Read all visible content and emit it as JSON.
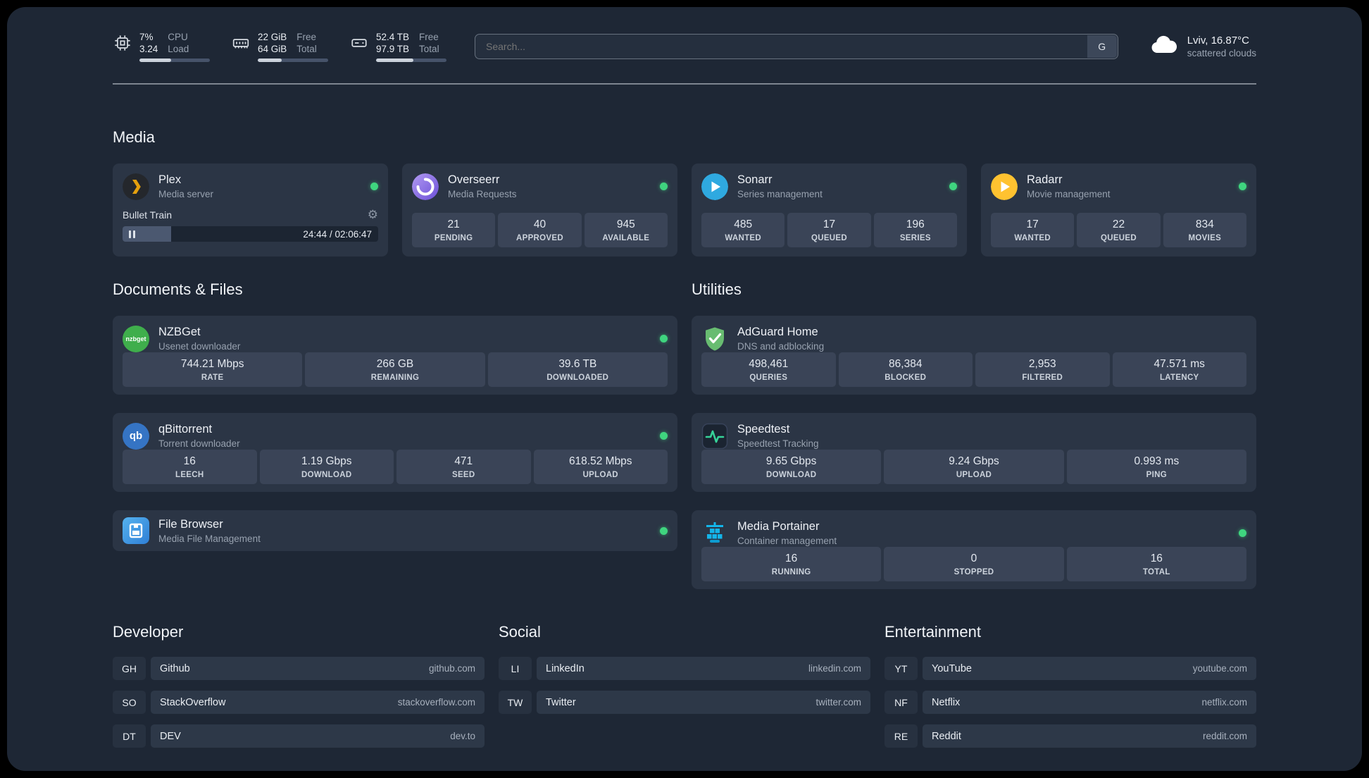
{
  "colors": {
    "page_bg": "#1e2735",
    "card_bg": "#2b3545",
    "status_online": "#3fd57f",
    "plex_amber": "#e5a00d",
    "sonarr_blue": "#2fa9e0",
    "radarr_amber": "#ffc230",
    "overseerr_purple": "#7c5ce0",
    "nzbget_green": "#3fae4c",
    "qbittorrent_blue": "#3574c4",
    "adguard_green": "#68bc71",
    "portainer_blue": "#13b5ea",
    "speedtest_green": "#36d399"
  },
  "topbar": {
    "metrics": [
      {
        "name": "cpu",
        "values": [
          "7%",
          "3.24"
        ],
        "labels": [
          "CPU",
          "Load"
        ],
        "progress": 45
      },
      {
        "name": "memory",
        "values": [
          "22 GiB",
          "64 GiB"
        ],
        "labels": [
          "Free",
          "Total"
        ],
        "progress": 34
      },
      {
        "name": "disk",
        "values": [
          "52.4 TB",
          "97.9 TB"
        ],
        "labels": [
          "Free",
          "Total"
        ],
        "progress": 53
      }
    ],
    "search": {
      "placeholder": "Search...",
      "button_label": "G"
    },
    "weather": {
      "location": "Lviv, 16.87°C",
      "condition": "scattered clouds"
    }
  },
  "sections": {
    "media": {
      "title": "Media"
    },
    "documents": {
      "title": "Documents & Files"
    },
    "utilities": {
      "title": "Utilities"
    },
    "developer": {
      "title": "Developer"
    },
    "social": {
      "title": "Social"
    },
    "entertainment": {
      "title": "Entertainment"
    }
  },
  "apps": {
    "plex": {
      "name": "Plex",
      "desc": "Media server",
      "status": "online",
      "player": {
        "title": "Bullet Train",
        "time": "24:44 / 02:06:47",
        "progress": 19
      }
    },
    "overseerr": {
      "name": "Overseerr",
      "desc": "Media Requests",
      "status": "online",
      "stats": [
        {
          "value": "21",
          "label": "PENDING"
        },
        {
          "value": "40",
          "label": "APPROVED"
        },
        {
          "value": "945",
          "label": "AVAILABLE"
        }
      ]
    },
    "sonarr": {
      "name": "Sonarr",
      "desc": "Series management",
      "status": "online",
      "stats": [
        {
          "value": "485",
          "label": "WANTED"
        },
        {
          "value": "17",
          "label": "QUEUED"
        },
        {
          "value": "196",
          "label": "SERIES"
        }
      ]
    },
    "radarr": {
      "name": "Radarr",
      "desc": "Movie management",
      "status": "online",
      "stats": [
        {
          "value": "17",
          "label": "WANTED"
        },
        {
          "value": "22",
          "label": "QUEUED"
        },
        {
          "value": "834",
          "label": "MOVIES"
        }
      ]
    },
    "nzbget": {
      "name": "NZBGet",
      "desc": "Usenet downloader",
      "status": "online",
      "icon_text": "nzbget",
      "stats": [
        {
          "value": "744.21 Mbps",
          "label": "RATE"
        },
        {
          "value": "266 GB",
          "label": "REMAINING"
        },
        {
          "value": "39.6 TB",
          "label": "DOWNLOADED"
        }
      ]
    },
    "qbittorrent": {
      "name": "qBittorrent",
      "desc": "Torrent downloader",
      "status": "online",
      "icon_text": "qb",
      "stats": [
        {
          "value": "16",
          "label": "LEECH"
        },
        {
          "value": "1.19 Gbps",
          "label": "DOWNLOAD"
        },
        {
          "value": "471",
          "label": "SEED"
        },
        {
          "value": "618.52 Mbps",
          "label": "UPLOAD"
        }
      ]
    },
    "filebrowser": {
      "name": "File Browser",
      "desc": "Media File Management",
      "status": "online"
    },
    "adguard": {
      "name": "AdGuard Home",
      "desc": "DNS and adblocking",
      "stats": [
        {
          "value": "498,461",
          "label": "QUERIES"
        },
        {
          "value": "86,384",
          "label": "BLOCKED"
        },
        {
          "value": "2,953",
          "label": "FILTERED"
        },
        {
          "value": "47.571 ms",
          "label": "LATENCY"
        }
      ]
    },
    "speedtest": {
      "name": "Speedtest",
      "desc": "Speedtest Tracking",
      "stats": [
        {
          "value": "9.65 Gbps",
          "label": "DOWNLOAD"
        },
        {
          "value": "9.24 Gbps",
          "label": "UPLOAD"
        },
        {
          "value": "0.993 ms",
          "label": "PING"
        }
      ]
    },
    "portainer": {
      "name": "Media Portainer",
      "desc": "Container management",
      "status": "online",
      "stats": [
        {
          "value": "16",
          "label": "RUNNING"
        },
        {
          "value": "0",
          "label": "STOPPED"
        },
        {
          "value": "16",
          "label": "TOTAL"
        }
      ]
    }
  },
  "bookmarks": {
    "developer": [
      {
        "abbr": "GH",
        "name": "Github",
        "url": "github.com"
      },
      {
        "abbr": "SO",
        "name": "StackOverflow",
        "url": "stackoverflow.com"
      },
      {
        "abbr": "DT",
        "name": "DEV",
        "url": "dev.to"
      }
    ],
    "social": [
      {
        "abbr": "LI",
        "name": "LinkedIn",
        "url": "linkedin.com"
      },
      {
        "abbr": "TW",
        "name": "Twitter",
        "url": "twitter.com"
      }
    ],
    "entertainment": [
      {
        "abbr": "YT",
        "name": "YouTube",
        "url": "youtube.com"
      },
      {
        "abbr": "NF",
        "name": "Netflix",
        "url": "netflix.com"
      },
      {
        "abbr": "RE",
        "name": "Reddit",
        "url": "reddit.com"
      }
    ]
  }
}
